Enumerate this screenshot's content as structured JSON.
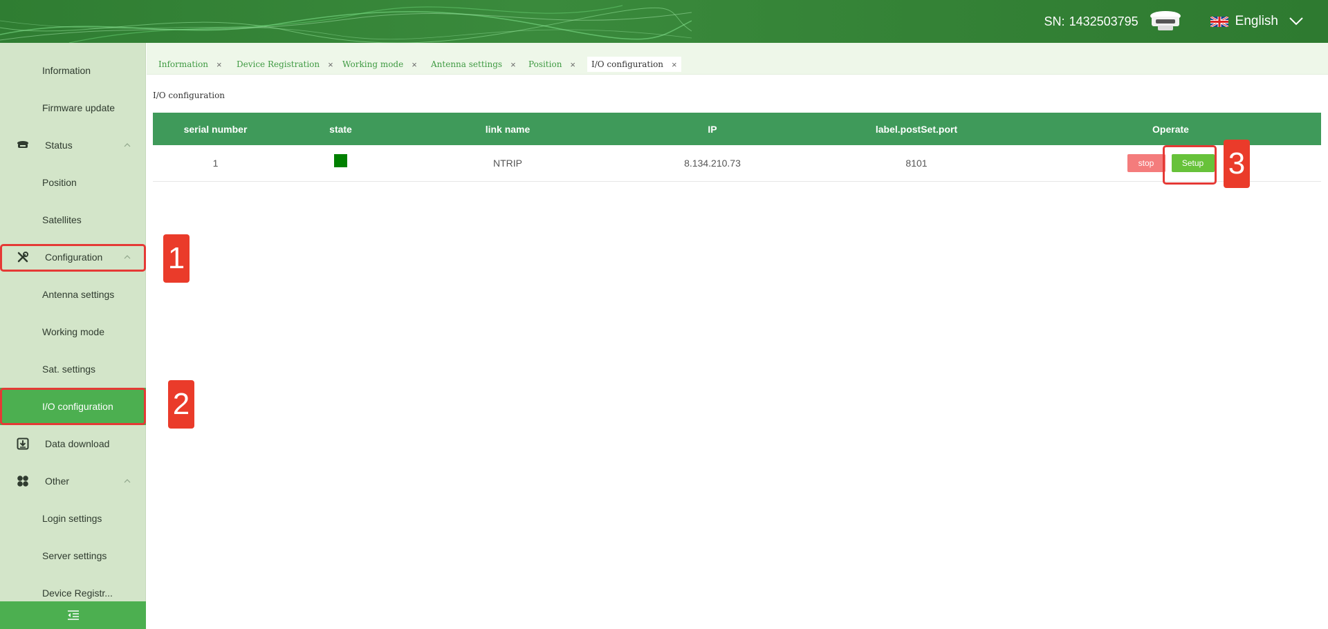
{
  "header": {
    "sn_label": "SN:",
    "sn_value": "1432503795",
    "language": "English"
  },
  "sidebar": {
    "items": [
      {
        "label": "Information"
      },
      {
        "label": "Firmware update"
      },
      {
        "label": "Status"
      },
      {
        "label": "Position"
      },
      {
        "label": "Satellites"
      },
      {
        "label": "Configuration"
      },
      {
        "label": "Antenna settings"
      },
      {
        "label": "Working mode"
      },
      {
        "label": "Sat. settings"
      },
      {
        "label": "I/O configuration"
      },
      {
        "label": "Data download"
      },
      {
        "label": "Other"
      },
      {
        "label": "Login settings"
      },
      {
        "label": "Server settings"
      },
      {
        "label": "Device Registr..."
      }
    ]
  },
  "tabs": [
    {
      "label": "Information"
    },
    {
      "label": "Device Registration"
    },
    {
      "label": "Working mode"
    },
    {
      "label": "Antenna settings"
    },
    {
      "label": "Position"
    },
    {
      "label": "I/O configuration"
    }
  ],
  "tab_close": "×",
  "page": {
    "title": "I/O configuration"
  },
  "table": {
    "columns": [
      "serial number",
      "state",
      "link name",
      "IP",
      "label.postSet.port",
      "Operate"
    ],
    "rows": [
      {
        "serial": "1",
        "link_name": "NTRIP",
        "ip": "8.134.210.73",
        "port": "8101",
        "state_color": "#008000"
      }
    ],
    "stop_label": "stop",
    "setup_label": "Setup"
  },
  "annotations": [
    "1",
    "2",
    "3"
  ],
  "colors": {
    "header": "#2f7d32",
    "sidebar": "#d3e5c9",
    "active": "#4caf50",
    "table_header": "#3f9a5a",
    "stop": "#f47c7c",
    "setup": "#67c23a",
    "annotation": "#e53935"
  }
}
